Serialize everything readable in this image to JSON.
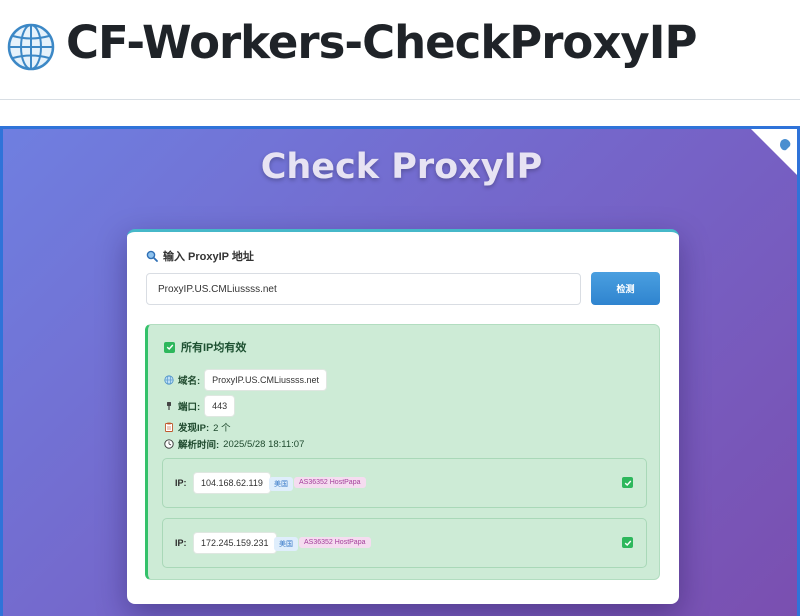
{
  "header": {
    "title": "CF-Workers-CheckProxyIP",
    "icon": "globe-icon"
  },
  "app": {
    "title": "Check ProxyIP",
    "input_label": "输入 ProxyIP 地址",
    "input_value": "ProxyIP.US.CMLiussss.net",
    "check_button_label": "检测"
  },
  "result": {
    "heading": "所有IP均有效",
    "domain_label": "域名:",
    "domain_value": "ProxyIP.US.CMLiussss.net",
    "port_label": "端口:",
    "port_value": "443",
    "found_label": "发现IP:",
    "found_value": "2 个",
    "time_label": "解析时间:",
    "time_value": "2025/5/28 18:11:07",
    "ips": [
      {
        "label": "IP:",
        "ip": "104.168.62.119",
        "country": "美国",
        "asn": "AS36352 HostPapa",
        "status": "valid"
      },
      {
        "label": "IP:",
        "ip": "172.245.159.231",
        "country": "美国",
        "asn": "AS36352 HostPapa",
        "status": "valid"
      }
    ]
  },
  "colors": {
    "accent": "#2f73d9",
    "success": "#2db75c",
    "button": "#3a8fd6"
  }
}
